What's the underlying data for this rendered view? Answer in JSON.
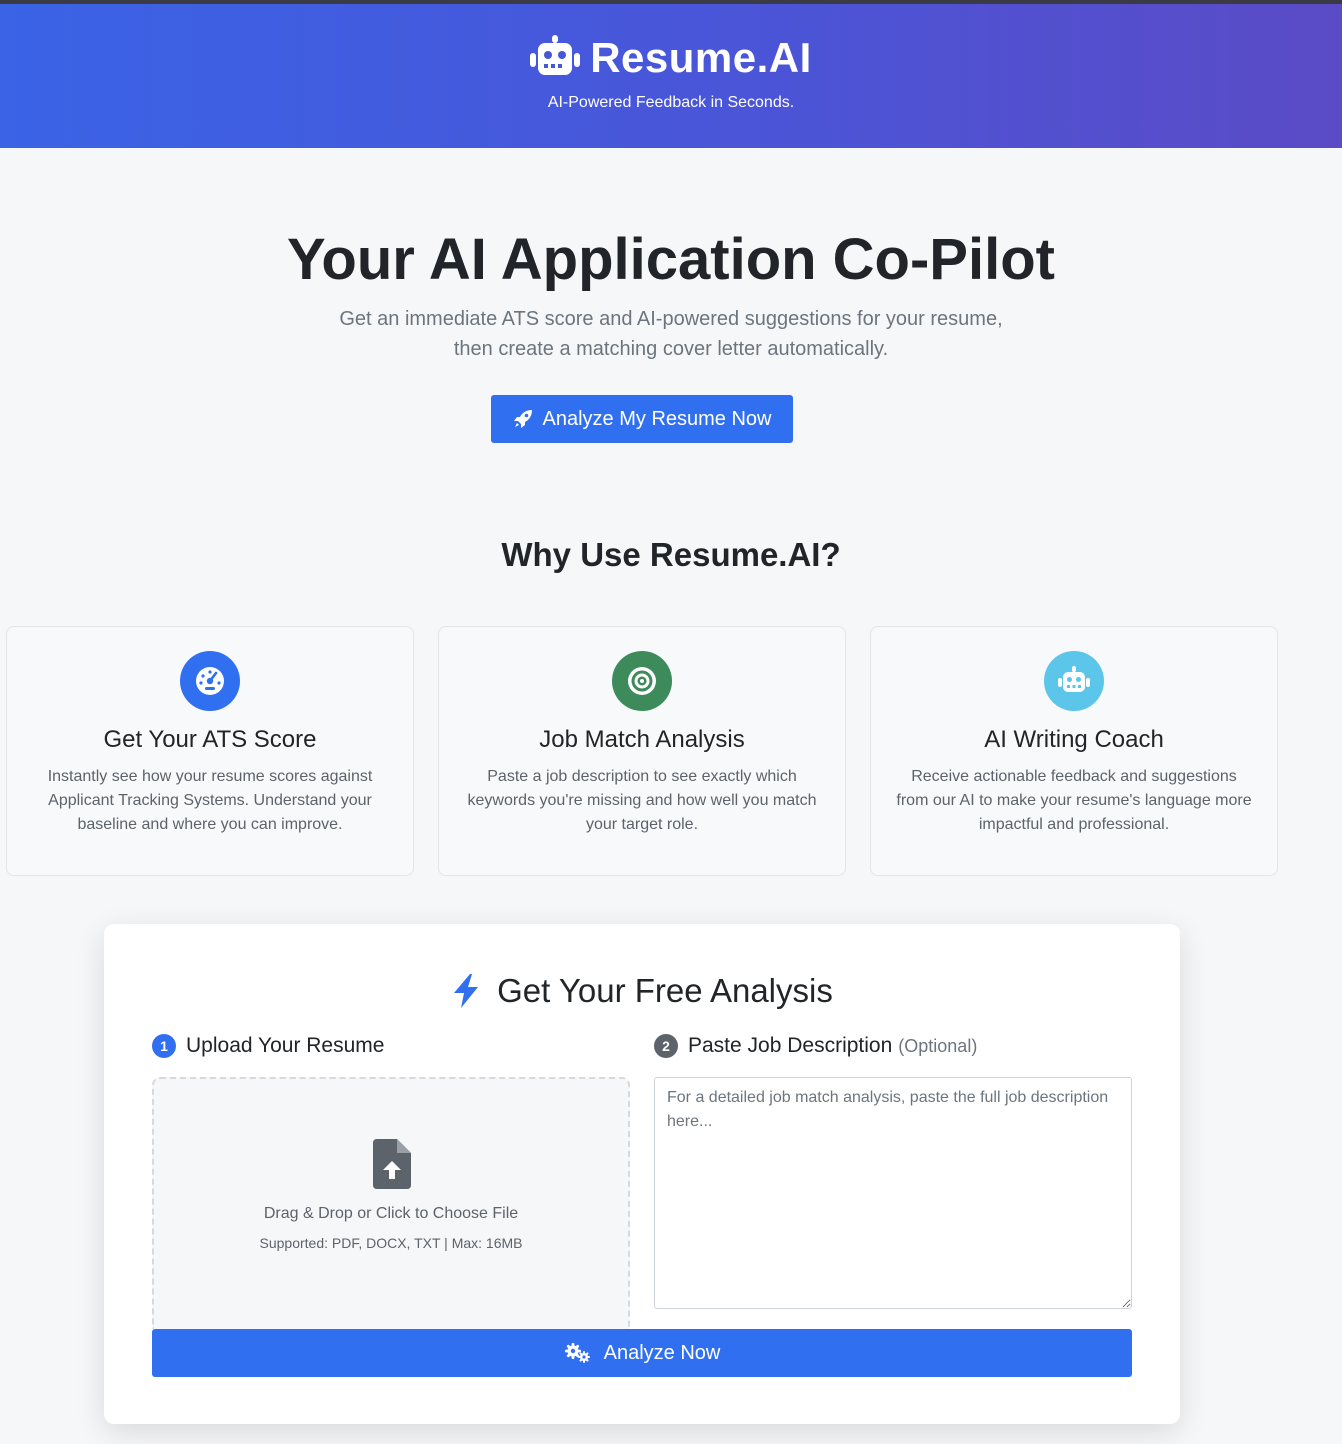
{
  "header": {
    "brand_name": "Resume.AI",
    "tagline": "AI-Powered Feedback in Seconds.",
    "brand_icon": "robot-icon"
  },
  "hero": {
    "title": "Your AI Application Co-Pilot",
    "subtitle": "Get an immediate ATS score and AI-powered suggestions for your resume, then create a matching cover letter automatically.",
    "cta_label": "Analyze My Resume Now",
    "cta_icon": "rocket-icon"
  },
  "why": {
    "title": "Why Use Resume.AI?",
    "features": [
      {
        "title": "Get Your ATS Score",
        "description": "Instantly see how your resume scores against Applicant Tracking Systems. Understand your baseline and where you can improve.",
        "icon": "gauge-icon",
        "color": "#3070f0"
      },
      {
        "title": "Job Match Analysis",
        "description": "Paste a job description to see exactly which keywords you're missing and how well you match your target role.",
        "icon": "target-icon",
        "color": "#3d8a5b"
      },
      {
        "title": "AI Writing Coach",
        "description": "Receive actionable feedback and suggestions from our AI to make your resume's language more impactful and professional.",
        "icon": "robot-icon",
        "color": "#5cc5ea"
      }
    ]
  },
  "analysis": {
    "title": "Get Your Free Analysis",
    "title_icon": "bolt-icon",
    "step1": {
      "number": "1",
      "label": "Upload Your Resume",
      "color": "#3070f0"
    },
    "step2": {
      "number": "2",
      "label": "Paste Job Description",
      "optional": "(Optional)",
      "color": "#5c636a"
    },
    "dropzone": {
      "text": "Drag & Drop or Click to Choose File",
      "subtext": "Supported: PDF, DOCX, TXT | Max: 16MB",
      "icon": "file-upload-icon"
    },
    "job_description": {
      "placeholder": "For a detailed job match analysis, paste the full job description here...",
      "value": ""
    },
    "submit_label": "Analyze Now",
    "submit_icon": "gears-icon"
  },
  "colors": {
    "primary": "#3070f0",
    "header_gradient_start": "#3a63e6",
    "header_gradient_end": "#5b4bc6"
  }
}
